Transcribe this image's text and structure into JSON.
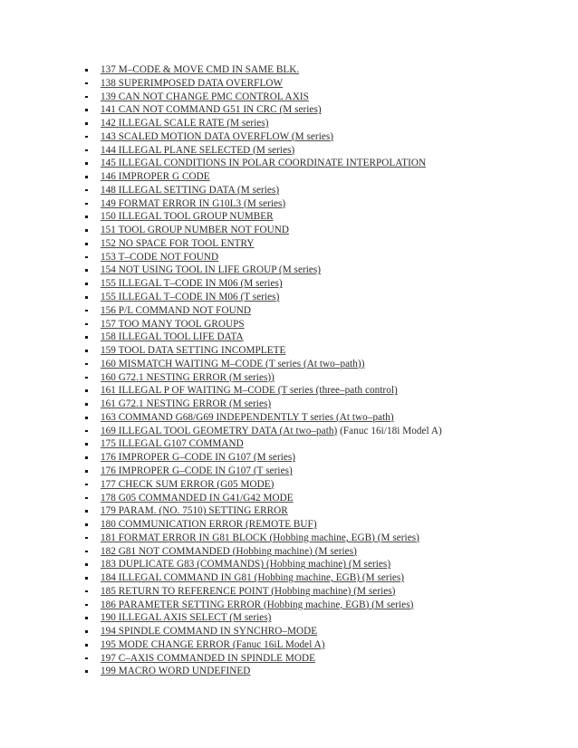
{
  "document": {
    "type": "alarm-code-list",
    "background_color": "#ffffff",
    "text_color": "#2b2b2b",
    "bullet_glyph": "square-bullet",
    "items": [
      {
        "text": "137 M–CODE & MOVE CMD IN SAME BLK."
      },
      {
        "text": "138 SUPERIMPOSED DATA OVERFLOW"
      },
      {
        "text": "139 CAN NOT CHANGE PMC CONTROL AXIS"
      },
      {
        "text": "141 CAN NOT COMMAND G51 IN CRC (M series)"
      },
      {
        "text": "142 ILLEGAL SCALE RATE (M series)"
      },
      {
        "text": "143 SCALED MOTION DATA OVERFLOW (M series)"
      },
      {
        "text": "144 ILLEGAL PLANE SELECTED (M series)"
      },
      {
        "text": "145 ILLEGAL CONDITIONS IN POLAR COORDINATE INTERPOLATION"
      },
      {
        "text": "146 IMPROPER G CODE"
      },
      {
        "text": "148 ILLEGAL SETTING DATA (M series)"
      },
      {
        "text": "149 FORMAT ERROR IN G10L3 (M series)"
      },
      {
        "text": "150 ILLEGAL TOOL GROUP NUMBER"
      },
      {
        "text": "151 TOOL GROUP NUMBER NOT FOUND"
      },
      {
        "text": "152 NO SPACE FOR TOOL ENTRY"
      },
      {
        "text": "153 T–CODE NOT FOUND"
      },
      {
        "text": "154 NOT USING TOOL IN LIFE GROUP (M series)"
      },
      {
        "text": "155 ILLEGAL T–CODE IN M06 (M series)"
      },
      {
        "text": "155 ILLEGAL T–CODE IN M06 (T series)"
      },
      {
        "text": "156 P/L COMMAND NOT FOUND"
      },
      {
        "text": "157 TOO MANY TOOL GROUPS"
      },
      {
        "text": "158 ILLEGAL TOOL LIFE DATA"
      },
      {
        "text": "159 TOOL DATA SETTING INCOMPLETE"
      },
      {
        "text": "160 MISMATCH WAITING M–CODE (T series (At two–path))"
      },
      {
        "text": "160 G72.1 NESTING ERROR (M series))"
      },
      {
        "text": "161 ILLEGAL P OF WAITING M–CODE (T series (three–path control)"
      },
      {
        "text": "161 G72.1 NESTING ERROR (M series)"
      },
      {
        "text": "163 COMMAND G68/G69 INDEPENDENTLY T series (At two–path)"
      },
      {
        "text": "169 ILLEGAL TOOL GEOMETRY DATA (At two–path)",
        "tail": " (Fanuc 16i/18i Model A)"
      },
      {
        "text": "175 ILLEGAL G107 COMMAND"
      },
      {
        "text": "176 IMPROPER G–CODE IN G107 (M series)"
      },
      {
        "text": "176 IMPROPER G–CODE IN G107 (T series)"
      },
      {
        "text": "177 CHECK SUM ERROR (G05 MODE)"
      },
      {
        "text": "178 G05 COMMANDED IN G41/G42 MODE"
      },
      {
        "text": "179 PARAM. (NO. 7510) SETTING ERROR"
      },
      {
        "text": "180 COMMUNICATION ERROR (REMOTE BUF)"
      },
      {
        "text": "181 FORMAT ERROR IN G81 BLOCK (Hobbing machine, EGB) (M series)"
      },
      {
        "text": "182 G81 NOT COMMANDED (Hobbing machine) (M series)"
      },
      {
        "text": "183 DUPLICATE G83 (COMMANDS) (Hobbing machine) (M series)"
      },
      {
        "text": "184 ILLEGAL COMMAND IN G81 (Hobbing machine, EGB) (M series)"
      },
      {
        "text": "185 RETURN TO REFERENCE POINT (Hobbing machine) (M series)"
      },
      {
        "text": "186 PARAMETER SETTING ERROR (Hobbing machine, EGB) (M series)"
      },
      {
        "text": "190 ILLEGAL AXIS SELECT (M series)"
      },
      {
        "text": "194 SPINDLE COMMAND IN SYNCHRO–MODE"
      },
      {
        "text": "195 MODE CHANGE ERROR (Fanuc 16iL Model A)"
      },
      {
        "text": "197 C–AXIS COMMANDED IN SPINDLE MODE"
      },
      {
        "text": "199 MACRO WORD UNDEFINED"
      }
    ]
  }
}
